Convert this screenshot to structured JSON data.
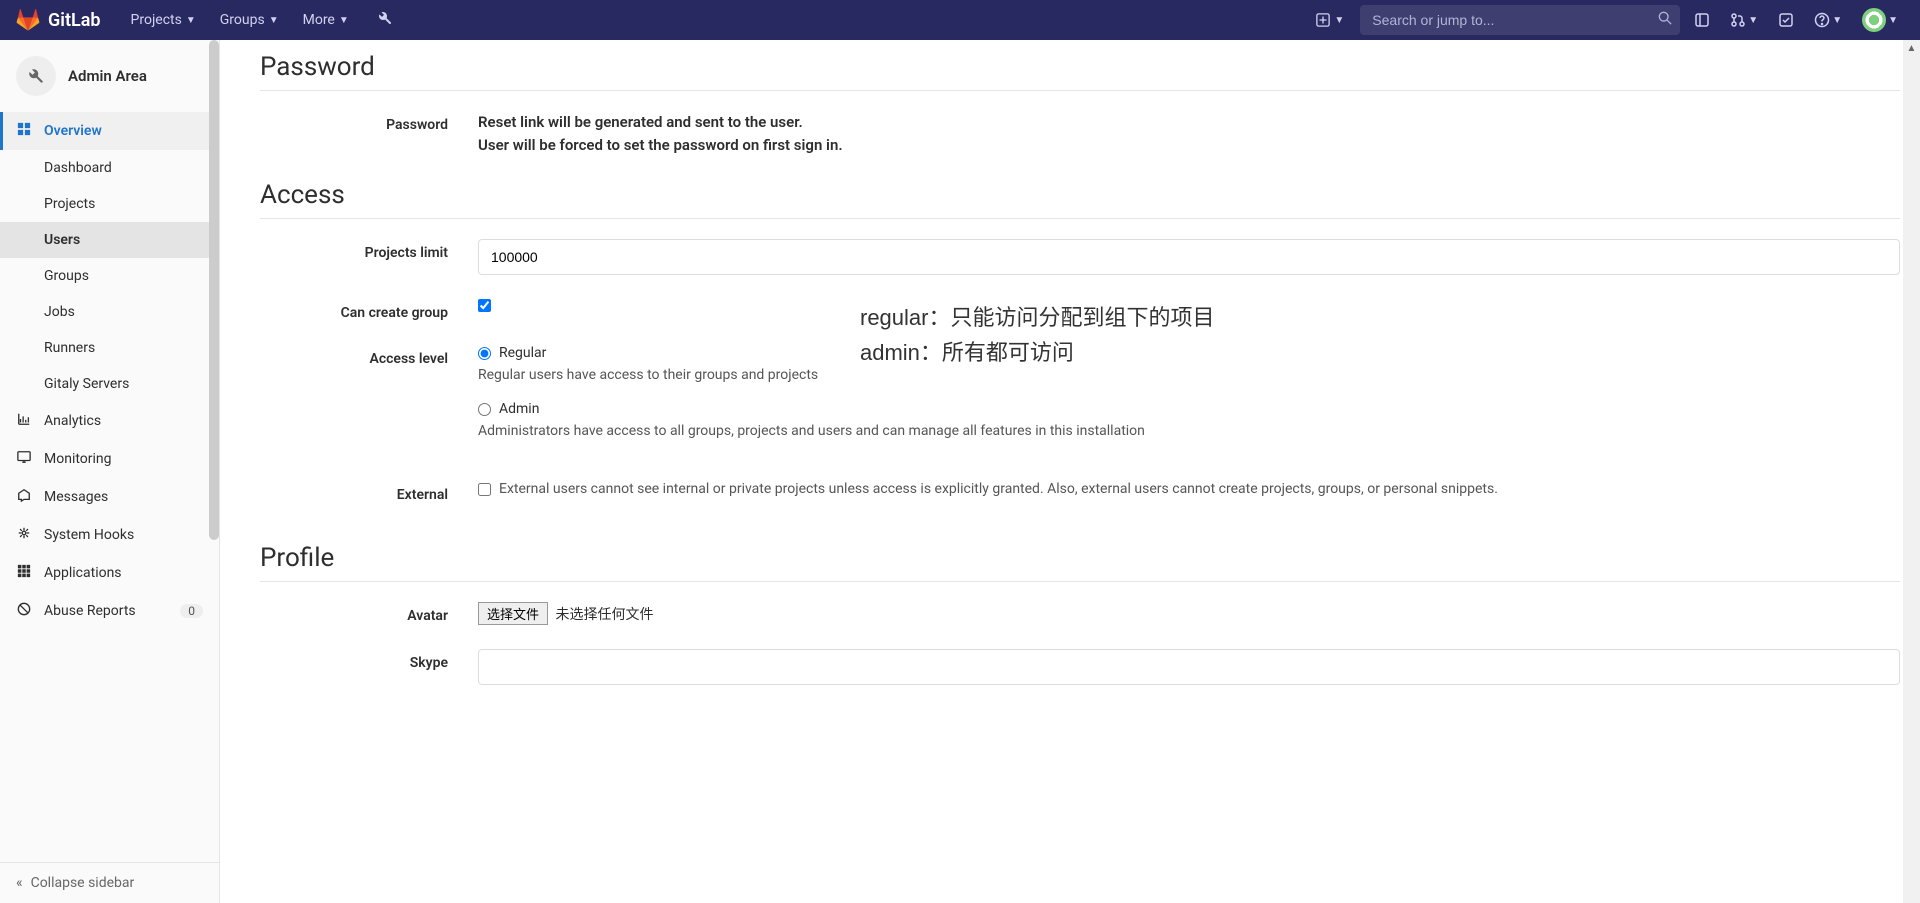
{
  "nav": {
    "brand": "GitLab",
    "projects": "Projects",
    "groups": "Groups",
    "more": "More",
    "search_placeholder": "Search or jump to..."
  },
  "sidebar": {
    "context": "Admin Area",
    "overview": "Overview",
    "sub": {
      "dashboard": "Dashboard",
      "projects": "Projects",
      "users": "Users",
      "groups": "Groups",
      "jobs": "Jobs",
      "runners": "Runners",
      "gitaly": "Gitaly Servers"
    },
    "analytics": "Analytics",
    "monitoring": "Monitoring",
    "messages": "Messages",
    "systemhooks": "System Hooks",
    "applications": "Applications",
    "abuse": "Abuse Reports",
    "abuse_count": "0",
    "collapse": "Collapse sidebar"
  },
  "sections": {
    "password": {
      "title": "Password",
      "label": "Password",
      "line1": "Reset link will be generated and sent to the user.",
      "line2": "User will be forced to set the password on first sign in."
    },
    "access": {
      "title": "Access",
      "projects_limit_label": "Projects limit",
      "projects_limit_value": "100000",
      "can_create_group_label": "Can create group",
      "access_level_label": "Access level",
      "regular": "Regular",
      "regular_help": "Regular users have access to their groups and projects",
      "admin": "Admin",
      "admin_help": "Administrators have access to all groups, projects and users and can manage all features in this installation",
      "external_label": "External",
      "external_help": "External users cannot see internal or private projects unless access is explicitly granted. Also, external users cannot create projects, groups, or personal snippets."
    },
    "profile": {
      "title": "Profile",
      "avatar_label": "Avatar",
      "file_button": "选择文件",
      "file_none": "未选择任何文件",
      "skype_label": "Skype"
    }
  },
  "annotation": {
    "line1": "regular：只能访问分配到组下的项目",
    "line2": "admin：所有都可访问"
  }
}
